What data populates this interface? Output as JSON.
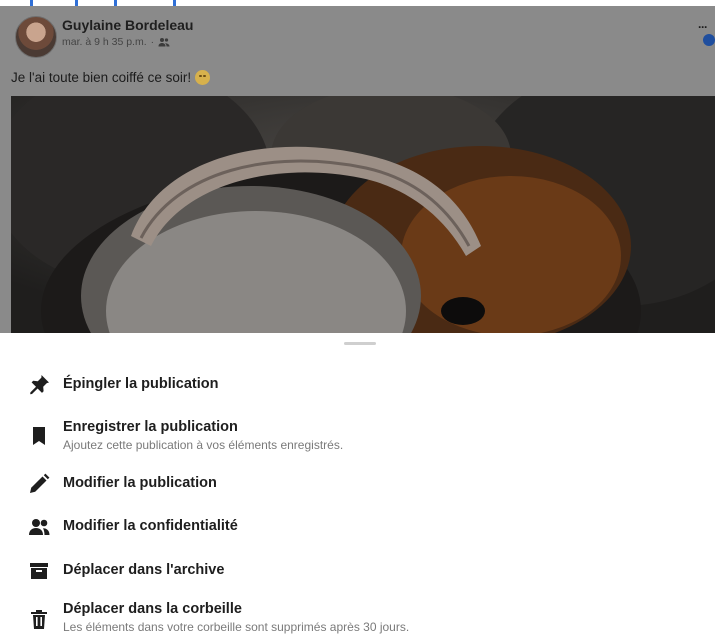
{
  "post": {
    "author": "Guylaine Bordeleau",
    "timestamp": "mar. à 9 h 35 p.m.",
    "separator": "·",
    "audience_icon": "friends-icon",
    "caption": "Je l'ai toute bien coiffé ce soir!",
    "caption_emoji": "smiling-face-emoji",
    "more_icon": "more-options-icon"
  },
  "menu": {
    "items": [
      {
        "icon": "pin-icon",
        "label": "Épingler la publication",
        "sub": ""
      },
      {
        "icon": "bookmark-icon",
        "label": "Enregistrer la publication",
        "sub": "Ajoutez cette publication à vos éléments enregistrés."
      },
      {
        "icon": "pencil-icon",
        "label": "Modifier la publication",
        "sub": ""
      },
      {
        "icon": "people-icon",
        "label": "Modifier la confidentialité",
        "sub": ""
      },
      {
        "icon": "archive-icon",
        "label": "Déplacer dans l'archive",
        "sub": ""
      },
      {
        "icon": "trash-icon",
        "label": "Déplacer dans la corbeille",
        "sub": "Les éléments dans votre corbeille sont supprimés après 30 jours."
      }
    ]
  },
  "colors": {
    "overlay": "#8a8a8a",
    "accent": "#1f4e9e",
    "text_primary": "#1e1e1e",
    "text_secondary": "#7a7a7a"
  }
}
